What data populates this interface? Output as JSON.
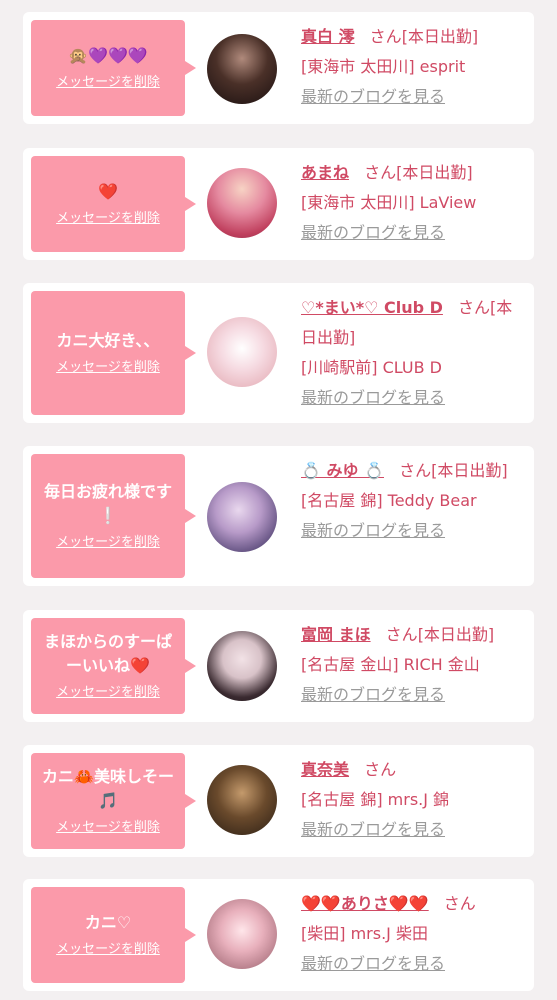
{
  "delete_label": "メッセージを削除",
  "san_suffix": "さん",
  "blog_label": "最新のブログを見る",
  "colors": {
    "bubble": "#fb9aaa",
    "accent": "#d04a64",
    "muted": "#9a9a9a"
  },
  "items": [
    {
      "message": "🙊💜💜💜",
      "name": "真白 澪",
      "status": "[本日出勤]",
      "shop": "[東海市 太田川] esprit"
    },
    {
      "message": "❤️",
      "name": "あまね",
      "status": "[本日出勤]",
      "shop": "[東海市 太田川] LaView"
    },
    {
      "message": "カニ大好き、、",
      "name": "♡*まい*♡ Club D",
      "status": "[本日出勤]",
      "shop": "[川崎駅前] CLUB D"
    },
    {
      "message": "毎日お疲れ様です❕",
      "name": "💍 みゆ 💍",
      "status": "[本日出勤]",
      "shop": "[名古屋 錦] Teddy Bear"
    },
    {
      "message": "まほからのすーぱーいいね❤️",
      "name": "富岡 まほ",
      "status": "[本日出勤]",
      "shop": "[名古屋 金山] RICH 金山"
    },
    {
      "message": "カニ🦀美味しそー🎵",
      "name": "真奈美",
      "status": "",
      "shop": "[名古屋 錦] mrs.J 錦"
    },
    {
      "message": "カニ♡",
      "name": "❤️❤️ありさ❤️❤️",
      "status": "",
      "shop": "[柴田] mrs.J 柴田"
    }
  ]
}
